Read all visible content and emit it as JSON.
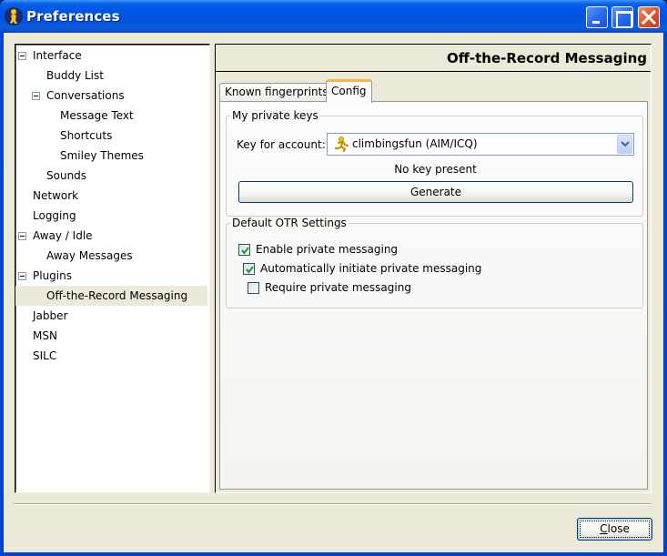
{
  "window": {
    "title": "Preferences",
    "app_icon": "pidgin-running-man-icon",
    "controls": {
      "minimize": "minimize-icon",
      "maximize": "maximize-icon",
      "close": "close-icon"
    }
  },
  "tree": {
    "items": [
      {
        "label": "Interface",
        "level": 0,
        "expander": "expanded"
      },
      {
        "label": "Buddy List",
        "level": 1
      },
      {
        "label": "Conversations",
        "level": 1,
        "expander": "expanded"
      },
      {
        "label": "Message Text",
        "level": 2
      },
      {
        "label": "Shortcuts",
        "level": 2
      },
      {
        "label": "Smiley Themes",
        "level": 2
      },
      {
        "label": "Sounds",
        "level": 1
      },
      {
        "label": "Network",
        "level": 0
      },
      {
        "label": "Logging",
        "level": 0
      },
      {
        "label": "Away / Idle",
        "level": 0,
        "expander": "expanded"
      },
      {
        "label": "Away Messages",
        "level": 1
      },
      {
        "label": "Plugins",
        "level": 0,
        "expander": "expanded"
      },
      {
        "label": "Off-the-Record Messaging",
        "level": 1,
        "selected": true
      },
      {
        "label": "Jabber",
        "level": 0
      },
      {
        "label": "MSN",
        "level": 0
      },
      {
        "label": "SILC",
        "level": 0
      }
    ]
  },
  "panel": {
    "title": "Off-the-Record Messaging",
    "tabs": [
      {
        "label": "Known fingerprints",
        "active": false
      },
      {
        "label": "Config",
        "active": true
      }
    ],
    "private_keys": {
      "group_title": "My private keys",
      "account_label": "Key for account:",
      "account_value": "climbingsfun (AIM/ICQ)",
      "account_icon": "aim-running-man-icon",
      "status": "No key present",
      "generate_label": "Generate"
    },
    "default_settings": {
      "group_title": "Default OTR Settings",
      "options": [
        {
          "label": "Enable private messaging",
          "checked": true
        },
        {
          "label": "Automatically initiate private messaging",
          "checked": true
        },
        {
          "label": "Require private messaging",
          "checked": false
        }
      ]
    }
  },
  "footer": {
    "close_label_mnemonic": "C",
    "close_label_rest": "lose"
  }
}
